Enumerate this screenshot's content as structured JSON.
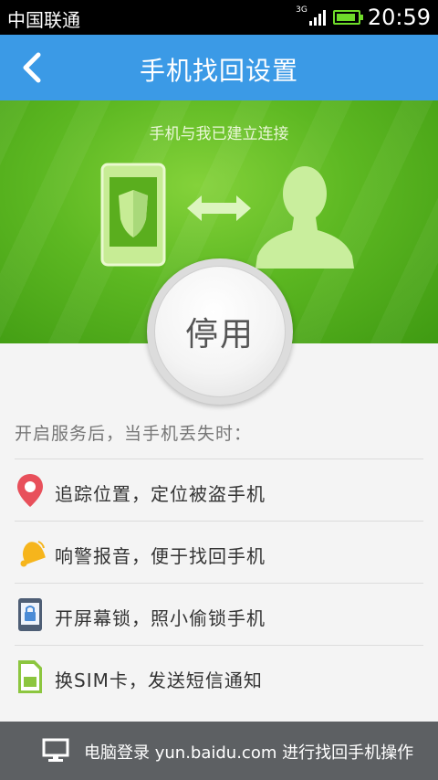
{
  "status_bar": {
    "carrier": "中国联通",
    "network": "3G",
    "time": "20:59",
    "battery_level": 0.9
  },
  "header": {
    "title": "手机找回设置",
    "back_icon": "chevron-left-icon"
  },
  "hero": {
    "caption": "手机与我已建立连接",
    "stop_button_label": "停用"
  },
  "services": {
    "intro": "开启服务后，当手机丢失时：",
    "items": [
      {
        "label": "追踪位置，定位被盗手机",
        "icon": "location-pin-icon",
        "color": "#e8505b"
      },
      {
        "label": "响警报音，便于找回手机",
        "icon": "bell-icon",
        "color": "#f6b51c"
      },
      {
        "label": "开屏幕锁，照小偷锁手机",
        "icon": "lock-phone-icon",
        "color": "#4a8bd6"
      },
      {
        "label": "换SIM卡，发送短信通知",
        "icon": "sim-card-icon",
        "color": "#8cc63f"
      }
    ]
  },
  "footer": {
    "text": "电脑登录 yun.baidu.com 进行找回手机操作",
    "icon": "monitor-icon"
  },
  "colors": {
    "header_bg": "#3b9ae6",
    "hero_green": "#5db822",
    "footer_bg": "#5d6063"
  }
}
